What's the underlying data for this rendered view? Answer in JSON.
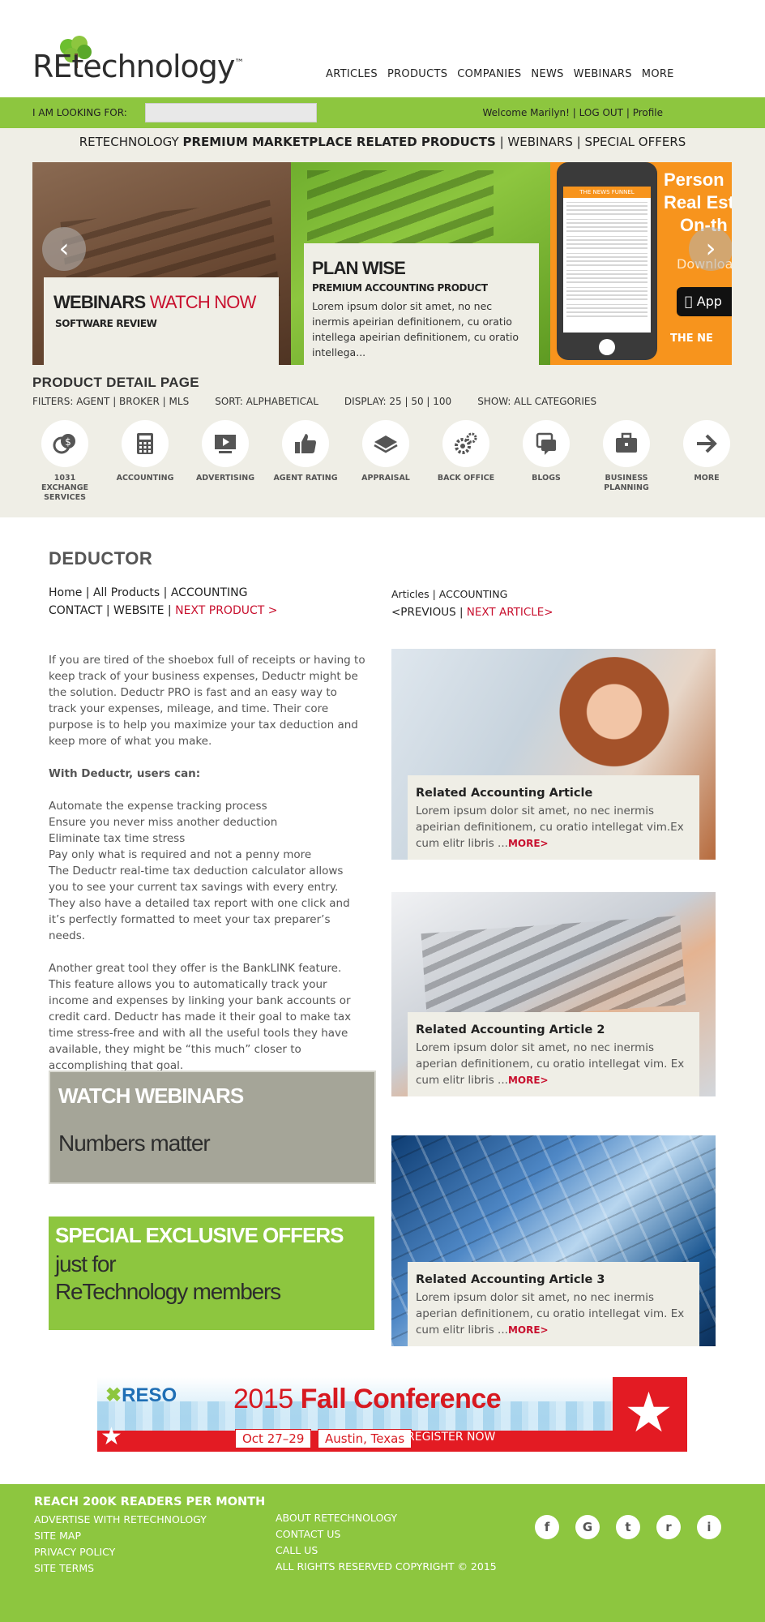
{
  "header": {
    "logo_text": "REtechnology",
    "logo_tm": "™",
    "nav": [
      "ARTICLES",
      "PRODUCTS",
      "COMPANIES",
      "NEWS",
      "WEBINARS",
      "MORE"
    ]
  },
  "searchbar": {
    "label": "I AM LOOKING FOR:",
    "input_value": "",
    "account": "Welcome Marilyn! | LOG OUT | Profile"
  },
  "subnav": {
    "prefix": "RETECHNOLOGY ",
    "bold": "PREMIUM MARKETPLACE RELATED PRODUCTS",
    "suffix": " | WEBINARS | SPECIAL OFFERS"
  },
  "carousel": {
    "slide1": {
      "title_dark": "WEBINARS",
      "title_red": "WATCH NOW",
      "subtitle": "SOFTWARE REVIEW"
    },
    "slide2": {
      "title": "PLAN WISE",
      "subtitle": "PREMIUM ACCOUNTING PRODUCT",
      "body": "Lorem ipsum dolor sit amet, no nec inermis apeirian definitionem, cu oratio intellega apeirian definitionem, cu oratio intellega..."
    },
    "slide3": {
      "phone_header": "THE NEWS FUNNEL",
      "promo_line1": "Person",
      "promo_line2": "Real Esta",
      "promo_line3": "On-th",
      "download": "Downloa",
      "app_button": "App",
      "brand": "THE NE"
    },
    "prev_icon": "chevron-left-icon",
    "next_icon": "chevron-right-icon"
  },
  "product_detail": {
    "title": "PRODUCT DETAIL PAGE",
    "filters": "FILTERS: AGENT | BROKER | MLS",
    "sort": "SORT:  ALPHABETICAL",
    "display": "DISPLAY: 25 | 50 | 100",
    "show": "SHOW: ALL CATEGORIES"
  },
  "categories": [
    {
      "label": "1031 EXCHANGE SERVICES",
      "icon": "coins-icon"
    },
    {
      "label": "ACCOUNTING",
      "icon": "calculator-icon"
    },
    {
      "label": "ADVERTISING",
      "icon": "video-play-icon"
    },
    {
      "label": "AGENT RATING",
      "icon": "thumbs-up-icon"
    },
    {
      "label": "APPRAISAL",
      "icon": "layers-icon"
    },
    {
      "label": "BACK OFFICE",
      "icon": "gears-icon"
    },
    {
      "label": "BLOGS",
      "icon": "chat-bubbles-icon"
    },
    {
      "label": "BUSINESS PLANNING",
      "icon": "briefcase-icon"
    },
    {
      "label": "MORE",
      "icon": "arrow-right-icon"
    }
  ],
  "article": {
    "title": "DEDUCTOR",
    "crumbs_line1": "Home | All Products | ACCOUNTING",
    "crumbs_line2_prefix": "CONTACT | WEBSITE | ",
    "next_product": "NEXT PRODUCT >",
    "right_crumbs": "Articles | ACCOUNTING",
    "prev_label": "<PREVIOUS | ",
    "next_article": "NEXT ARTICLE>",
    "p1": "If you are tired of the shoebox full of receipts or having to keep track of your business expenses, Deductr might be the solution. Deductr PRO is fast and an easy way to track your expenses, mileage, and time. Their core purpose is to help you maximize your tax deduction and keep more of what you make.",
    "p2": "With Deductr, users can:",
    "list": [
      "Automate the expense tracking process",
      "Ensure you never miss another deduction",
      "Eliminate tax time stress",
      "Pay only what is required and not a penny more"
    ],
    "p3": "The Deductr real-time tax deduction calculator allows you to see your current tax savings with every entry. They also have a detailed tax report with one click and it’s perfectly formatted to meet your tax preparer’s needs.",
    "p4": "Another great tool they offer is the BankLINK feature. This feature allows you to automatically track your income and expenses by linking your bank accounts or credit card. Deductr has made it their goal to make tax time stress-free and with all the useful tools they have available, they might be “this much” closer to accomplishing that goal."
  },
  "promos": {
    "webinars_title": "WATCH WEBINARS",
    "webinars_sub": "Numbers matter",
    "offers_title": "SPECIAL EXCLUSIVE OFFERS",
    "offers_sub1": "just for",
    "offers_sub2": "ReTechnology members"
  },
  "related": [
    {
      "title": "Related Accounting Article",
      "body": "Lorem ipsum dolor sit amet, no nec inermis apeirian definitionem, cu oratio intellegat vim.Ex cum elitr libris ...",
      "more": "MORE>"
    },
    {
      "title": "Related Accounting Article 2",
      "body": "Lorem ipsum dolor sit amet, no nec inermis aperian definitionem, cu oratio intellegat vim. Ex cum elitr libris ...",
      "more": "MORE>"
    },
    {
      "title": "Related Accounting Article 3",
      "body": "Lorem ipsum dolor sit amet, no nec inermis aperian definitionem, cu oratio intellegat vim. Ex cum elitr libris ...",
      "more": "MORE>"
    }
  ],
  "banner": {
    "reso": "RESO",
    "year": "2015 ",
    "title": "Fall Conference",
    "dates": "Oct 27–29",
    "city": "Austin, Texas",
    "register": "REGISTER NOW"
  },
  "footer": {
    "heading": "REACH 200K READERS PER MONTH",
    "col1": [
      "ADVERTISE WITH RETECHNOLOGY",
      "SITE MAP",
      "PRIVACY POLICY",
      "SITE TERMS"
    ],
    "col2": [
      "ABOUT RETECHNOLOGY",
      "CONTACT US",
      "CALL US",
      "ALL RIGHTS RESERVED COPYRIGHT © 2015"
    ],
    "social": [
      {
        "glyph": "f",
        "icon": "facebook-icon"
      },
      {
        "glyph": "G",
        "icon": "google-plus-icon"
      },
      {
        "glyph": "t",
        "icon": "twitter-icon"
      },
      {
        "glyph": "r",
        "icon": "rss-icon"
      },
      {
        "glyph": "i",
        "icon": "image-icon"
      }
    ]
  },
  "colors": {
    "brand_green": "#8dc63f",
    "beige": "#efeee6",
    "accent_red": "#c8102e",
    "promo_orange": "#f7941d"
  }
}
